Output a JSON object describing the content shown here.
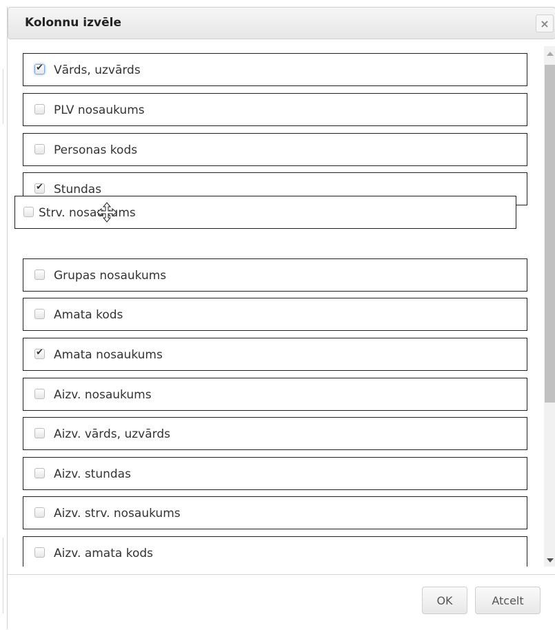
{
  "dialog": {
    "title": "Kolonnu izvēle",
    "close_icon": "×"
  },
  "items": [
    {
      "label": "Vārds, uzvārds",
      "checked": true
    },
    {
      "label": "PLV nosaukums",
      "checked": false
    },
    {
      "label": "Personas kods",
      "checked": false
    },
    {
      "label": "Stundas",
      "checked": true
    },
    {
      "label": "Grupas nosaukums",
      "checked": false
    },
    {
      "label": "Amata kods",
      "checked": false
    },
    {
      "label": "Amata nosaukums",
      "checked": true
    },
    {
      "label": "Aizv. nosaukums",
      "checked": false
    },
    {
      "label": "Aizv. vārds, uzvārds",
      "checked": false
    },
    {
      "label": "Aizv. stundas",
      "checked": false
    },
    {
      "label": "Aizv. strv. nosaukums",
      "checked": false
    },
    {
      "label": "Aizv. amata kods",
      "checked": false
    }
  ],
  "dragging_item": {
    "label": "Strv. nosaukums",
    "checked": false
  },
  "buttons": {
    "ok_label": "OK",
    "cancel_label": "Atcelt"
  },
  "icons": {
    "close": "close-icon",
    "move_cursor": "move-cursor-icon",
    "checkbox": "checkbox-icon",
    "scroll_up": "chevron-up-icon",
    "scroll_down": "chevron-down-icon"
  }
}
